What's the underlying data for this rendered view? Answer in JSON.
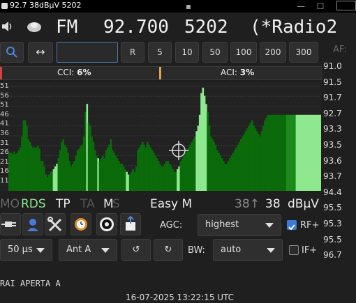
{
  "window": {
    "title": "92.7 38dBµV 5202"
  },
  "header": {
    "band": "FM",
    "frequency": "92.700",
    "pi": "5202",
    "ps": "(*Radio2"
  },
  "toolbar": {
    "buttons": [
      "R",
      "5",
      "10",
      "50",
      "100",
      "200",
      "300"
    ],
    "af_label": "AF:",
    "freq_input_value": ""
  },
  "interference": {
    "cci_label": "CCI:",
    "cci_value": "6%",
    "aci_label": "ACI:",
    "aci_value": "3%"
  },
  "af_list": [
    "91.0",
    "91.5",
    "91.7",
    "92.7",
    "93.3",
    "93.5",
    "93.6",
    "93.7",
    "94.4",
    "95.5",
    "95.3",
    "95.5",
    "96.7"
  ],
  "status": {
    "mo": "MO",
    "rds": "RDS",
    "tp": "TP",
    "ta": "TA",
    "ms_m": "M",
    "ms_s": "S",
    "mode": "Easy M",
    "signal_small": "38↑",
    "signal": "38",
    "unit": "dBµV"
  },
  "controls": {
    "agc_label": "AGC:",
    "agc_value": "highest",
    "rf_label": "RF+",
    "rf_checked": true,
    "deemphasis": "50 µs",
    "antenna": "Ant A",
    "bw_label": "BW:",
    "bw_value": "auto",
    "if_label": "IF+",
    "if_checked": false
  },
  "radiotext": "RAI APERTA A",
  "timestamp": "16-07-2025 13:22:15 UTC",
  "colors": {
    "spectrum_dark": "#0b6b0b",
    "spectrum_light": "#8ee88e",
    "accent": "#4a78b0",
    "rds_active": "#8ee88e"
  },
  "chart_data": {
    "type": "area",
    "y_tick_labels": [
      "51",
      "56",
      "51",
      "46",
      "41",
      "36",
      "31",
      "26",
      "21",
      "16",
      "11"
    ],
    "series": [
      {
        "values": [
          28,
          28,
          27,
          29,
          27,
          28,
          30,
          32,
          40,
          52,
          52,
          48,
          38,
          36,
          33,
          32,
          32,
          32,
          33,
          31,
          22,
          22,
          18,
          12,
          10,
          12,
          14,
          14,
          16,
          18,
          20,
          24,
          30,
          36,
          38,
          34,
          32,
          28,
          22,
          18,
          20,
          22,
          26,
          30,
          31,
          33,
          34,
          40,
          58,
          64,
          50,
          48,
          40,
          36,
          30,
          26,
          24,
          22,
          24,
          26,
          24,
          30,
          32,
          34,
          38,
          30,
          28,
          26,
          24,
          22,
          20,
          20,
          18,
          16,
          14,
          12,
          12,
          14,
          16,
          14,
          18,
          30,
          32,
          34,
          36,
          34,
          32,
          36,
          34,
          32,
          30,
          28,
          26,
          24,
          22,
          20,
          18,
          18,
          20,
          22,
          22,
          20,
          18,
          16,
          14,
          14,
          16,
          18,
          22,
          24,
          26,
          28,
          30,
          32,
          34,
          36,
          38,
          40,
          44,
          48,
          56,
          72,
          76,
          70,
          64,
          58,
          48,
          40,
          38,
          36,
          34,
          30,
          28,
          26,
          24,
          22,
          20,
          20,
          22,
          24,
          26,
          28,
          30,
          32,
          34,
          36,
          38,
          40,
          42,
          44,
          46,
          48,
          50,
          52,
          48,
          46,
          44,
          42,
          40,
          44,
          48,
          52,
          54,
          56,
          56,
          56,
          56,
          56,
          56,
          56,
          56,
          56,
          56,
          56,
          56,
          56,
          56,
          56,
          56,
          56,
          56,
          56,
          56,
          56,
          56,
          56,
          56,
          56,
          56,
          56,
          56,
          56,
          56,
          56,
          56,
          56,
          56
        ]
      }
    ]
  }
}
